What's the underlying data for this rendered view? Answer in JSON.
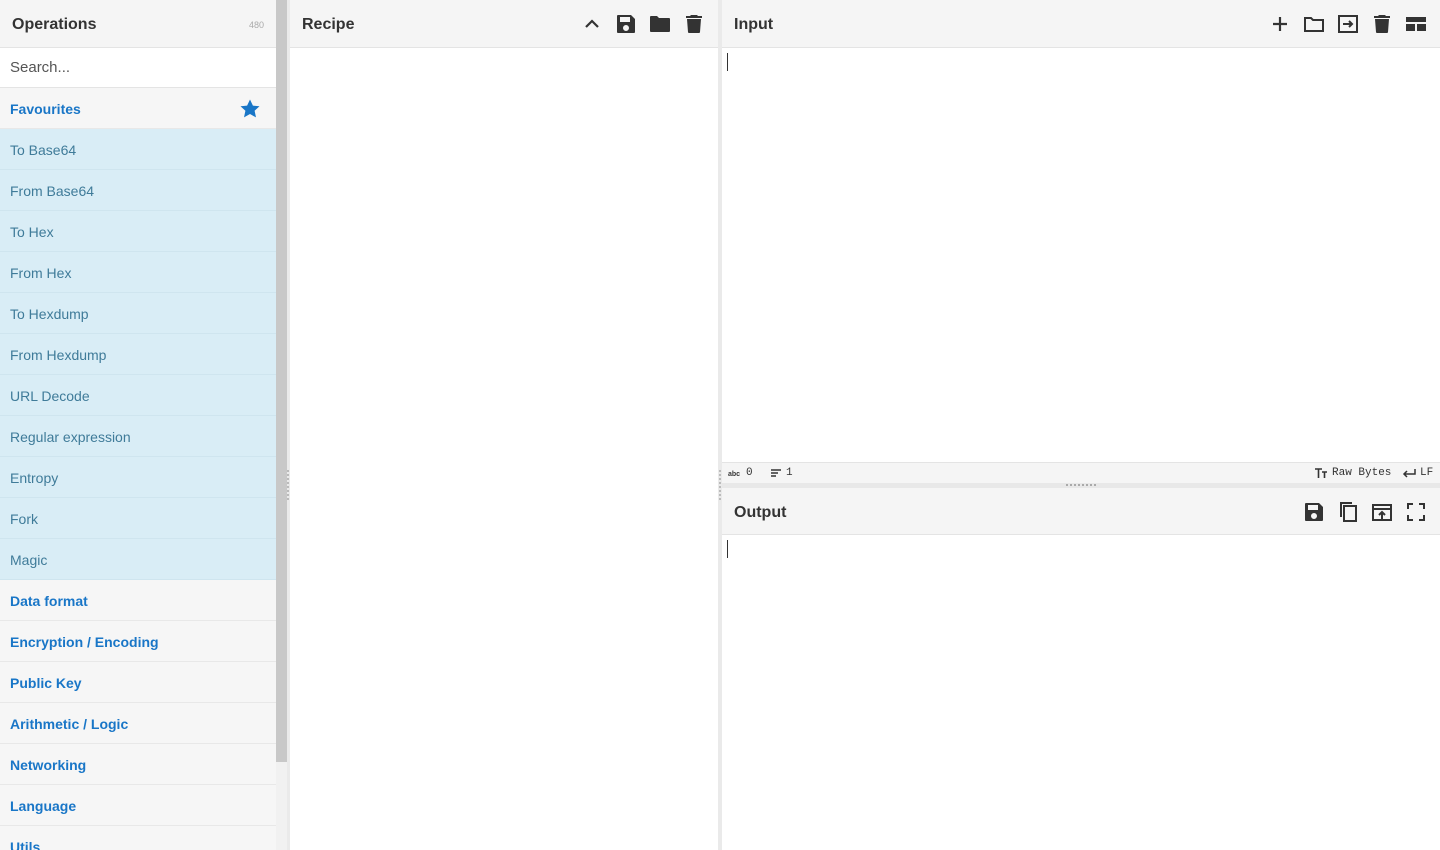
{
  "operations": {
    "title": "Operations",
    "count": "480",
    "search_placeholder": "Search...",
    "favourites": {
      "label": "Favourites",
      "items": [
        {
          "label": "To Base64"
        },
        {
          "label": "From Base64"
        },
        {
          "label": "To Hex"
        },
        {
          "label": "From Hex"
        },
        {
          "label": "To Hexdump"
        },
        {
          "label": "From Hexdump"
        },
        {
          "label": "URL Decode"
        },
        {
          "label": "Regular expression"
        },
        {
          "label": "Entropy"
        },
        {
          "label": "Fork"
        },
        {
          "label": "Magic"
        }
      ]
    },
    "categories": [
      {
        "label": "Data format"
      },
      {
        "label": "Encryption / Encoding"
      },
      {
        "label": "Public Key"
      },
      {
        "label": "Arithmetic / Logic"
      },
      {
        "label": "Networking"
      },
      {
        "label": "Language"
      },
      {
        "label": "Utils"
      }
    ]
  },
  "recipe": {
    "title": "Recipe",
    "buttons": [
      "chevron-up-icon",
      "save-icon",
      "folder-icon",
      "trash-icon"
    ]
  },
  "input": {
    "title": "Input",
    "buttons": [
      "plus-icon",
      "folder-open-icon",
      "input-arrow-icon",
      "trash-icon",
      "layout-icon"
    ],
    "value": "",
    "status": {
      "chars": "0",
      "lines": "1",
      "encoding": "Raw Bytes",
      "eol": "LF"
    }
  },
  "output": {
    "title": "Output",
    "buttons": [
      "save-icon",
      "copy-icon",
      "replace-input-icon",
      "maximise-icon"
    ],
    "value": ""
  },
  "colors": {
    "accent": "#1976c7",
    "favourite_bg": "#d9edf6",
    "favourite_text": "#3f7b99",
    "header_bg": "#f5f5f5"
  }
}
